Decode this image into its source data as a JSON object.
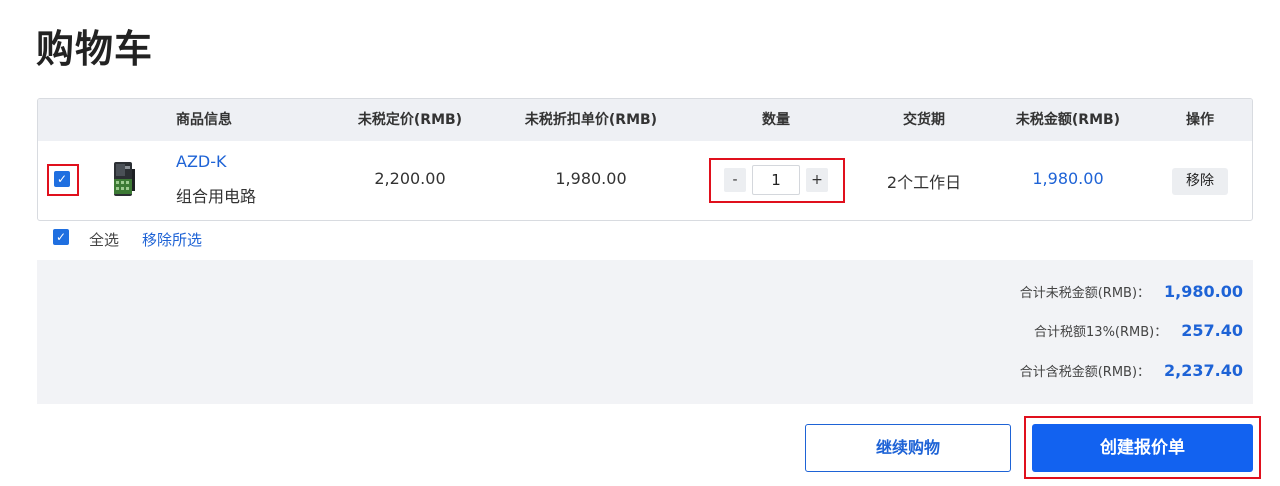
{
  "page": {
    "title": "购物车"
  },
  "table": {
    "headers": {
      "product_info": "商品信息",
      "list_price": "未税定价(RMB)",
      "discount_price": "未税折扣单价(RMB)",
      "quantity": "数量",
      "delivery": "交货期",
      "amount": "未税金额(RMB)",
      "operation": "操作"
    },
    "rows": [
      {
        "checked": true,
        "product_image": "control-module-image",
        "name": "AZD-K",
        "description": "组合用电路",
        "list_price": "2,200.00",
        "discount_price": "1,980.00",
        "quantity_minus": "-",
        "quantity": "1",
        "quantity_plus": "+",
        "delivery": "2个工作日",
        "amount": "1,980.00",
        "remove_label": "移除"
      }
    ]
  },
  "selection": {
    "checked": true,
    "select_all_label": "全选",
    "remove_selected_label": "移除所选"
  },
  "summary": {
    "subtotal_label": "合计未税金额(RMB)：",
    "subtotal_value": "1,980.00",
    "tax_label": "合计税额13%(RMB)：",
    "tax_value": "257.40",
    "total_label": "合计含税金额(RMB)：",
    "total_value": "2,237.40"
  },
  "actions": {
    "continue_label": "继续购物",
    "create_quote_label": "创建报价单"
  },
  "icons": {
    "checkbox": "checkmark-icon"
  },
  "colors": {
    "accent": "#1262f0",
    "link": "#1e63d6",
    "highlight": "#e0101d"
  }
}
